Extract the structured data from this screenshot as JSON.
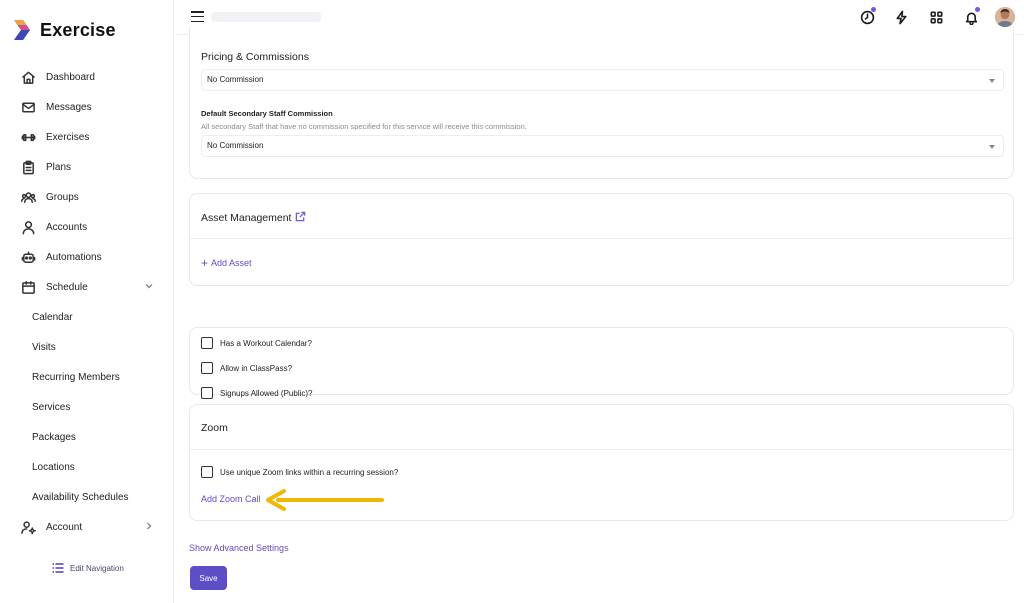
{
  "app": {
    "brand_name": "Exercise"
  },
  "sidebar": {
    "items": [
      {
        "label": "Dashboard",
        "icon": "home-icon"
      },
      {
        "label": "Messages",
        "icon": "mail-icon"
      },
      {
        "label": "Exercises",
        "icon": "dumbbell-icon"
      },
      {
        "label": "Plans",
        "icon": "clipboard-icon"
      },
      {
        "label": "Groups",
        "icon": "users-icon"
      },
      {
        "label": "Accounts",
        "icon": "user-icon"
      },
      {
        "label": "Automations",
        "icon": "robot-icon"
      },
      {
        "label": "Schedule",
        "icon": "calendar-icon"
      }
    ],
    "schedule_sub": [
      "Calendar",
      "Visits",
      "Recurring Members",
      "Services",
      "Packages",
      "Locations",
      "Availability Schedules"
    ],
    "account_label": "Account",
    "edit_navigation": "Edit Navigation"
  },
  "pricing": {
    "title": "Pricing & Commissions",
    "first_select": "No Commission",
    "secondary_label": "Default Secondary Staff Commission",
    "secondary_hint": "All secondary Staff that have no commission specified for this service will receive this commission.",
    "secondary_select": "No Commission"
  },
  "assets": {
    "title": "Asset Management",
    "add_asset": "Add Asset"
  },
  "options": {
    "items": [
      "Has a Workout Calendar?",
      "Allow in ClassPass?",
      "Signups Allowed (Public)?"
    ]
  },
  "zoom": {
    "title": "Zoom",
    "unique_links": "Use unique Zoom links within a recurring session?",
    "add_call": "Add Zoom Call"
  },
  "footer": {
    "advanced": "Show Advanced Settings",
    "save": "Save"
  },
  "colors": {
    "accent": "#5b4ec7",
    "annotation_arrow": "#f2b705"
  }
}
